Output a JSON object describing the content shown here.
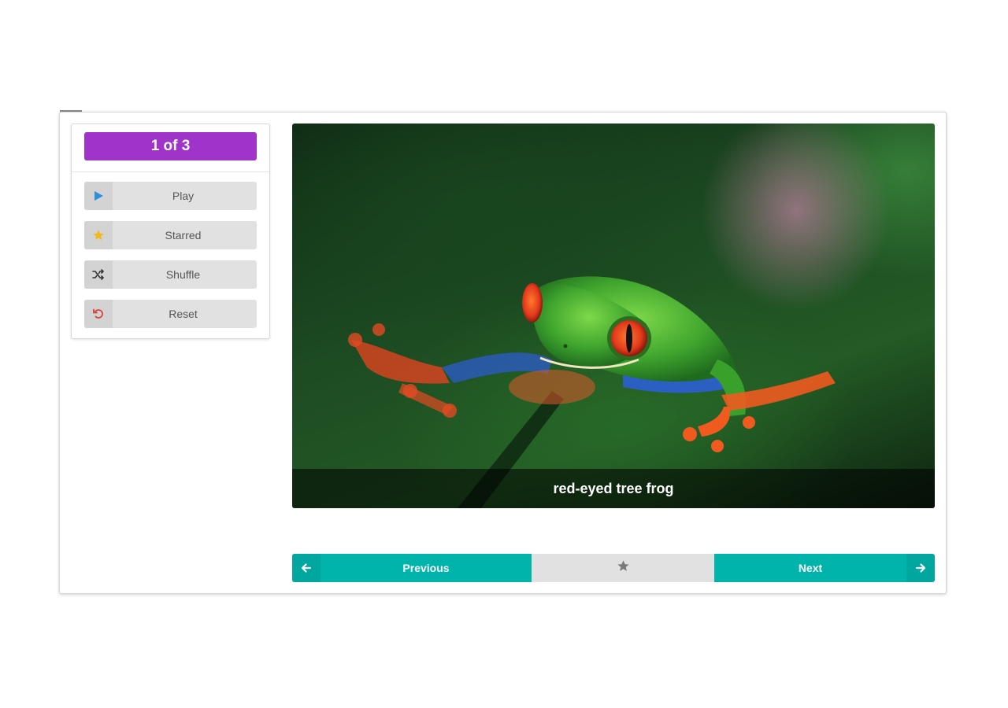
{
  "colors": {
    "accent_purple": "#a033c9",
    "teal": "#00b4ac",
    "play_blue": "#2f8fd8",
    "star_gold": "#f2b81a",
    "reset_red": "#d9443a",
    "muted_star": "#7a7a7a"
  },
  "counter": {
    "text": "1 of 3"
  },
  "controls": [
    {
      "label": "Play",
      "icon": "play-icon"
    },
    {
      "label": "Starred",
      "icon": "star-icon"
    },
    {
      "label": "Shuffle",
      "icon": "shuffle-icon"
    },
    {
      "label": "Reset",
      "icon": "reset-icon"
    }
  ],
  "slide": {
    "caption": "red-eyed tree frog",
    "image": "red-eyed-tree-frog-photo"
  },
  "navigation": {
    "previous_label": "Previous",
    "next_label": "Next",
    "prev_icon": "arrow-left-icon",
    "next_icon": "arrow-right-icon",
    "star_icon": "star-icon"
  }
}
